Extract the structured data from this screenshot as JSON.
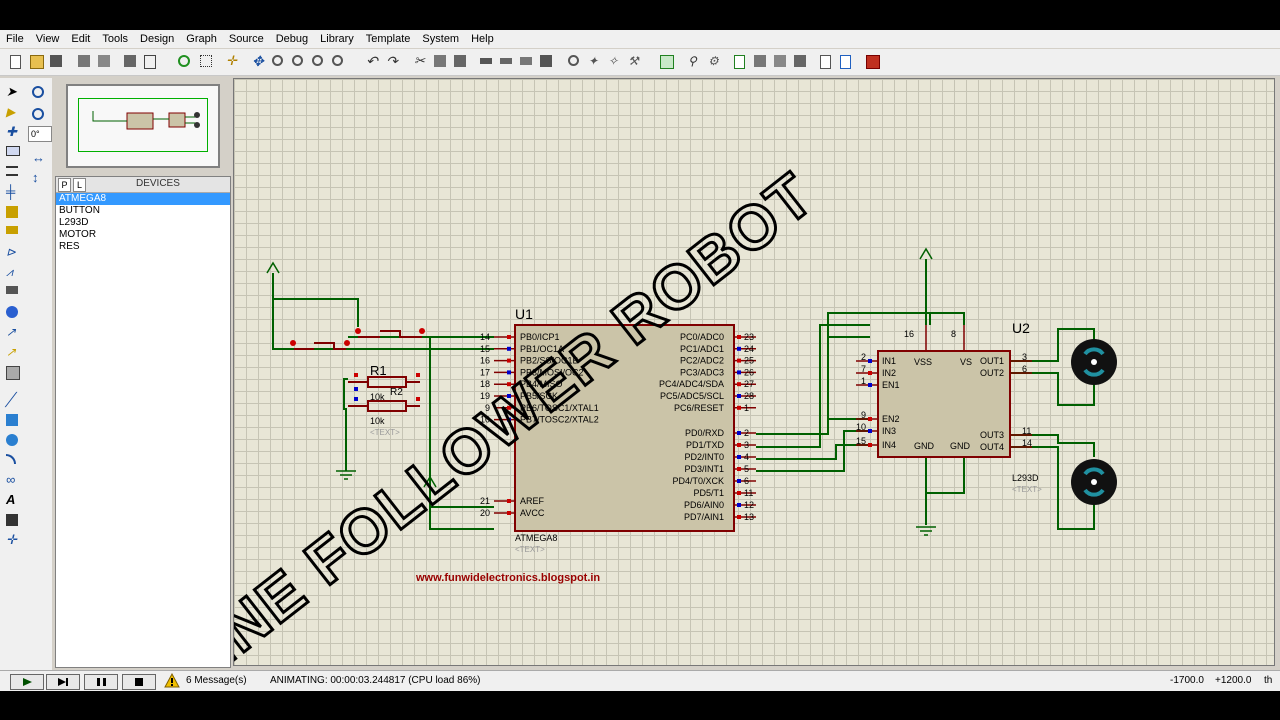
{
  "menu": [
    "File",
    "View",
    "Edit",
    "Tools",
    "Design",
    "Graph",
    "Source",
    "Debug",
    "Library",
    "Template",
    "System",
    "Help"
  ],
  "rotation_input": "0°",
  "devices": {
    "tab_p": "P",
    "tab_l": "L",
    "title": "DEVICES",
    "items": [
      "ATMEGA8",
      "BUTTON",
      "L293D",
      "MOTOR",
      "RES"
    ]
  },
  "overlay_title": "LINE FOLLOWER ROBOT",
  "website": "www.funwidelectronics.blogspot.in",
  "u1": {
    "ref": "U1",
    "part": "ATMEGA8",
    "text_tag": "<TEXT>",
    "left_pins": [
      {
        "num": "14",
        "label": "PB0/ICP1"
      },
      {
        "num": "15",
        "label": "PB1/OC1A"
      },
      {
        "num": "16",
        "label": "PB2/SS/OC1B"
      },
      {
        "num": "17",
        "label": "PB3/MOSI/OC2"
      },
      {
        "num": "18",
        "label": "PB4/MISO"
      },
      {
        "num": "19",
        "label": "PB5/SCK"
      },
      {
        "num": "9",
        "label": "PB6/TOSC1/XTAL1"
      },
      {
        "num": "10",
        "label": "PB7/TOSC2/XTAL2"
      }
    ],
    "left_bottom_pins": [
      {
        "num": "21",
        "label": "AREF"
      },
      {
        "num": "20",
        "label": "AVCC"
      }
    ],
    "right_pins": [
      {
        "num": "23",
        "label": "PC0/ADC0"
      },
      {
        "num": "24",
        "label": "PC1/ADC1"
      },
      {
        "num": "25",
        "label": "PC2/ADC2"
      },
      {
        "num": "26",
        "label": "PC3/ADC3"
      },
      {
        "num": "27",
        "label": "PC4/ADC4/SDA"
      },
      {
        "num": "28",
        "label": "PC5/ADC5/SCL"
      },
      {
        "num": "1",
        "label": "PC6/RESET"
      },
      {
        "num": "2",
        "label": "PD0/RXD"
      },
      {
        "num": "3",
        "label": "PD1/TXD"
      },
      {
        "num": "4",
        "label": "PD2/INT0"
      },
      {
        "num": "5",
        "label": "PD3/INT1"
      },
      {
        "num": "6",
        "label": "PD4/T0/XCK"
      },
      {
        "num": "11",
        "label": "PD5/T1"
      },
      {
        "num": "12",
        "label": "PD6/AIN0"
      },
      {
        "num": "13",
        "label": "PD7/AIN1"
      }
    ]
  },
  "u2": {
    "ref": "U2",
    "part": "L293D",
    "text_tag": "<TEXT>",
    "top_pins": [
      {
        "num": "16",
        "label": "VSS"
      },
      {
        "num": "8",
        "label": "VS"
      }
    ],
    "left_pins": [
      {
        "num": "2",
        "label": "IN1"
      },
      {
        "num": "7",
        "label": "IN2"
      },
      {
        "num": "1",
        "label": "EN1"
      },
      {
        "num": "9",
        "label": "EN2"
      },
      {
        "num": "10",
        "label": "IN3"
      },
      {
        "num": "15",
        "label": "IN4"
      }
    ],
    "right_pins": [
      {
        "num": "3",
        "label": "OUT1"
      },
      {
        "num": "6",
        "label": "OUT2"
      },
      {
        "num": "11",
        "label": "OUT3"
      },
      {
        "num": "14",
        "label": "OUT4"
      }
    ],
    "bottom_labels": [
      "GND",
      "GND"
    ]
  },
  "resistors": {
    "r1": {
      "ref": "R1",
      "value": "10k",
      "text_tag": "<TEXT>"
    },
    "r2": {
      "ref": "R2",
      "value": "10k"
    }
  },
  "status": {
    "messages": "6 Message(s)",
    "animating": "ANIMATING: 00:00:03.244817 (CPU load 86%)",
    "coord_x": "-1700.0",
    "coord_y": "+1200.0",
    "unit": "th"
  },
  "colors": {
    "wire": "#006000",
    "component": "#800000",
    "chip_fill": "#cbc4a8",
    "canvas_bg": "#e8e6d6",
    "pin_red": "#cc0000",
    "pin_blue": "#0000cc"
  }
}
